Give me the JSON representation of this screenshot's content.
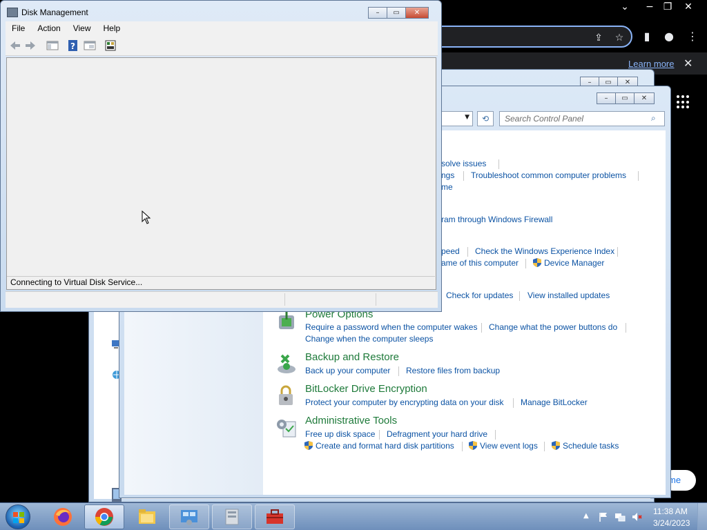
{
  "chrome": {
    "learn_more": "Learn more",
    "home_partial": "me"
  },
  "control_panel": {
    "search_placeholder": "Search Control Panel",
    "partial_links": {
      "resolve_issues": "solve issues",
      "settings": "ngs",
      "troubleshoot": "Troubleshoot common computer problems",
      "me": "me",
      "firewall": "ram through Windows Firewall",
      "speed": "peed",
      "experience_index": "Check the Windows Experience Index",
      "computer_name": "ame of this computer",
      "device_manager": "Device Manager",
      "check_updates": "Check for updates",
      "installed_updates": "View installed updates"
    },
    "sections": [
      {
        "title": "Power Options",
        "links": [
          "Require a password when the computer wakes",
          "Change what the power buttons do",
          "Change when the computer sleeps"
        ]
      },
      {
        "title": "Backup and Restore",
        "links": [
          "Back up your computer",
          "Restore files from backup"
        ]
      },
      {
        "title": "BitLocker Drive Encryption",
        "links": [
          "Protect your computer by encrypting data on your disk",
          "Manage BitLocker"
        ]
      },
      {
        "title": "Administrative Tools",
        "links": [
          "Free up disk space",
          "Defragment your hard drive",
          "Create and format hard disk partitions",
          "View event logs",
          "Schedule tasks"
        ]
      }
    ]
  },
  "disk_management": {
    "title": "Disk Management",
    "menu": [
      "File",
      "Action",
      "View",
      "Help"
    ],
    "status": "Connecting to Virtual Disk Service..."
  },
  "taskbar": {
    "time": "11:38 AM",
    "date": "3/24/2023",
    "icons": [
      "windows-start-icon",
      "firefox-icon",
      "chrome-icon",
      "file-explorer-icon",
      "control-panel-icon",
      "disk-management-icon",
      "toolbox-icon"
    ]
  },
  "colors": {
    "link": "#0b52a3",
    "heading": "#1e7a3a",
    "chrome_accent": "#8ab4f8"
  }
}
